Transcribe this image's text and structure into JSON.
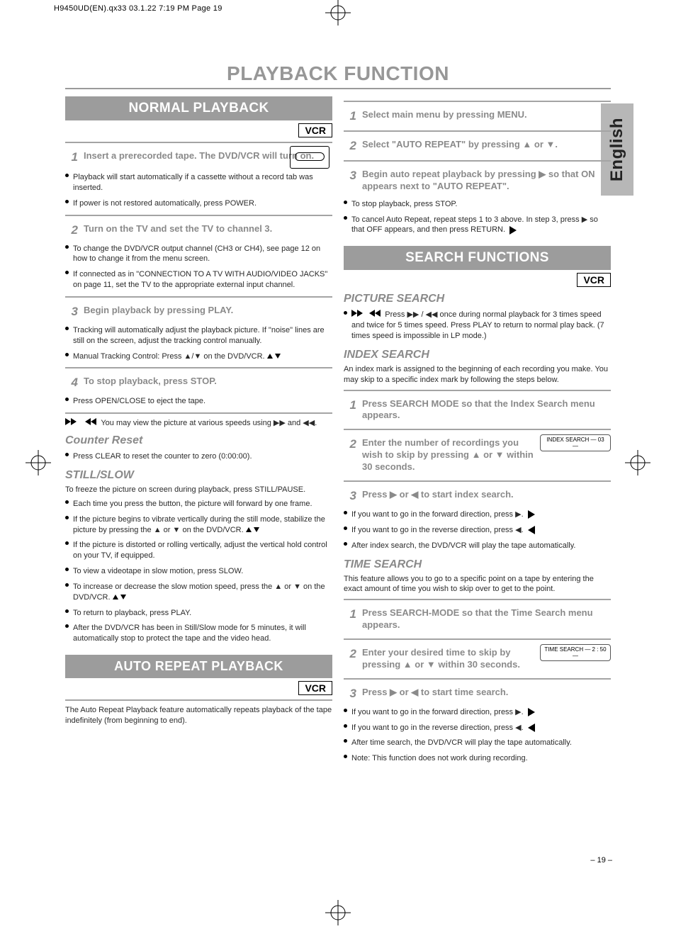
{
  "slug": "H9450UD(EN).qx33  03.1.22 7:19 PM  Page 19",
  "language_tab": "English",
  "page_title": "PLAYBACK FUNCTION",
  "vcr_label": "VCR",
  "page_number": "– 19 –",
  "left": {
    "section1": {
      "banner": "NORMAL PLAYBACK",
      "steps": {
        "s1": {
          "num": "1",
          "text": "Insert a prerecorded tape. The DVD/VCR will turn on."
        },
        "s1_b1": "Playback will start automatically if a cassette without a record tab was inserted.",
        "s1_b2": "If power is not restored automatically, press POWER.",
        "s2": {
          "num": "2",
          "text": "Turn on the TV and set the TV to channel 3."
        },
        "s2_b1": "To change the DVD/VCR output channel (CH3 or CH4), see page 12 on how to change it from the menu screen.",
        "s2_b2": "If connected as in \"CONNECTION TO A TV WITH AUDIO/VIDEO JACKS\" on page 11, set the TV to the appropriate external input channel.",
        "s3": {
          "num": "3",
          "text": "Begin playback by pressing PLAY."
        },
        "s3_b1": "Tracking will automatically adjust the playback picture. If \"noise\" lines are still on the screen, adjust the tracking control manually.",
        "s3_b2": "Manual Tracking Control: Press ▲/▼ on the DVD/VCR.",
        "s4": {
          "num": "4",
          "text": "To stop playback, press STOP."
        },
        "s4_b1": "Press OPEN/CLOSE to eject the tape."
      },
      "body_after": "You may view the picture at various speeds using ▶▶ and ◀◀.",
      "counter_reset": {
        "heading": "Counter Reset",
        "bullet": "Press CLEAR to reset the counter to zero (0:00:00)."
      },
      "stillslow": {
        "heading": "STILL/SLOW",
        "intro": "To freeze the picture on screen during playback, press STILL/PAUSE.",
        "b1": "Each time you press the button, the picture will forward by one frame.",
        "b2": "If the picture begins to vibrate vertically during the still mode, stabilize the picture by pressing the ▲ or ▼ on the DVD/VCR.",
        "b3": "If the picture is distorted or rolling vertically, adjust the vertical hold control on your TV, if equipped.",
        "b4": "To view a videotape in slow motion, press SLOW.",
        "b5": "To increase or decrease the slow motion speed, press the ▲ or ▼ on the DVD/VCR.",
        "b6": "To return to playback, press PLAY.",
        "b7": "After the DVD/VCR has been in Still/Slow mode for 5 minutes, it will automatically stop to protect the tape and the video head."
      }
    },
    "section2": {
      "banner": "AUTO REPEAT PLAYBACK",
      "desc": "The Auto Repeat Playback feature automatically repeats playback of the tape indefinitely (from beginning to end)."
    }
  },
  "right": {
    "steps_top": {
      "s1": {
        "num": "1",
        "text": "Select main menu by pressing MENU."
      },
      "s2": {
        "num": "2",
        "text": "Select \"AUTO REPEAT\" by pressing ▲ or ▼."
      },
      "s3": {
        "num": "3",
        "text": "Begin auto repeat playback by pressing ▶ so that ON appears next to \"AUTO REPEAT\"."
      },
      "s3_b1": "To stop playback, press STOP.",
      "s3_b2": "To cancel Auto Repeat, repeat steps 1 to 3 above. In step 3, press ▶ so that OFF appears, and then press RETURN."
    },
    "section2": {
      "banner": "SEARCH FUNCTIONS",
      "picture": {
        "heading": "PICTURE SEARCH",
        "bullet": "Press ▶▶ / ◀◀ once during normal playback for 3 times speed and twice for 5 times speed. Press PLAY to return to normal play back. (7 times speed is impossible in LP mode.)"
      },
      "index": {
        "heading": "INDEX SEARCH",
        "intro": "An index mark is assigned to the beginning of each recording you make. You may skip to a specific index mark by following the steps below.",
        "s1": {
          "num": "1",
          "text": "Press SEARCH MODE so that the Index Search menu appears."
        },
        "s2": {
          "num": "2",
          "text": "Enter the number of recordings you wish to skip by pressing ▲ or ▼ within 30 seconds."
        },
        "osd2": "INDEX SEARCH\n— 03 —",
        "s3": {
          "num": "3",
          "text": "Press ▶ or ◀ to start index search."
        },
        "s3_b1": "If you want to go in the forward direction, press ▶.",
        "s3_b2": "If you want to go in the reverse direction, press ◀.",
        "s3_b3": "After index search, the DVD/VCR will play the tape automatically."
      },
      "time": {
        "heading": "TIME SEARCH",
        "intro": "This feature allows you to go to a specific point on a tape by entering the exact amount of time you wish to skip over to get to the point.",
        "s1": {
          "num": "1",
          "text": "Press SEARCH-MODE so that the Time Search menu appears."
        },
        "s2": {
          "num": "2",
          "text": "Enter your desired time to skip by pressing ▲ or ▼ within 30 seconds."
        },
        "osd2": "TIME SEARCH\n— 2 : 50 —",
        "s3": {
          "num": "3",
          "text": "Press ▶ or ◀ to start time search."
        },
        "s3_b1": "If you want to go in the forward direction, press ▶.",
        "s3_b2": "If you want to go in the reverse direction, press ◀.",
        "s3_b3": "After time search, the DVD/VCR will play the tape automatically.",
        "s3_note": "Note: This function does not work during recording."
      }
    }
  }
}
